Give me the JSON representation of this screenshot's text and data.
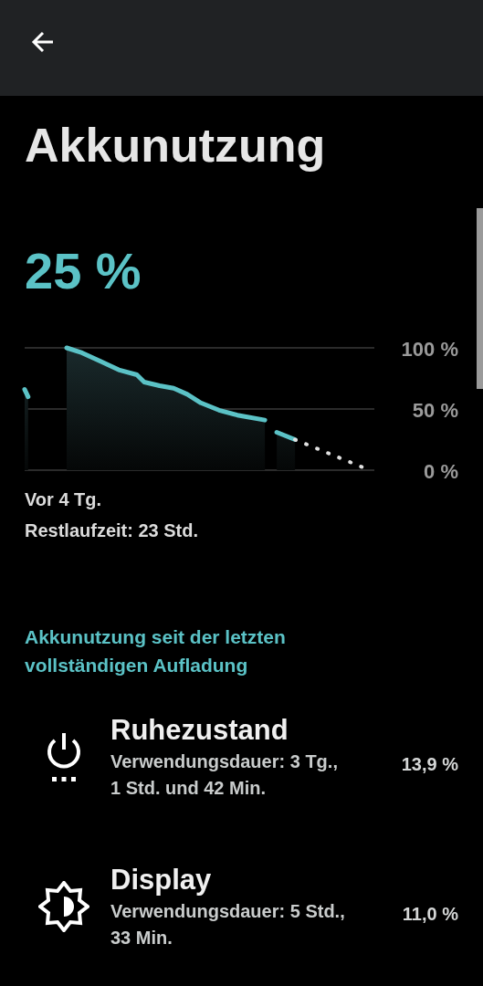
{
  "title": "Akkunutzung",
  "battery_level_text": "25 %",
  "chart": {
    "axis_labels": [
      "100 %",
      "50 %",
      "0 %"
    ]
  },
  "since_label": "Vor 4 Tg.",
  "remaining": "Restlaufzeit: 23 Std.",
  "section_title": "Akkunutzung seit der letzten vollständigen Aufladung",
  "items": [
    {
      "kind": "sleep",
      "name": "Ruhezustand",
      "detail": "Verwendungsdauer: 3 Tg., 1 Std. und 42 Min.",
      "percent": "13,9 %"
    },
    {
      "kind": "display",
      "name": "Display",
      "detail": "Verwendungsdauer: 5 Std., 33 Min.",
      "percent": "11,0 %"
    }
  ]
}
